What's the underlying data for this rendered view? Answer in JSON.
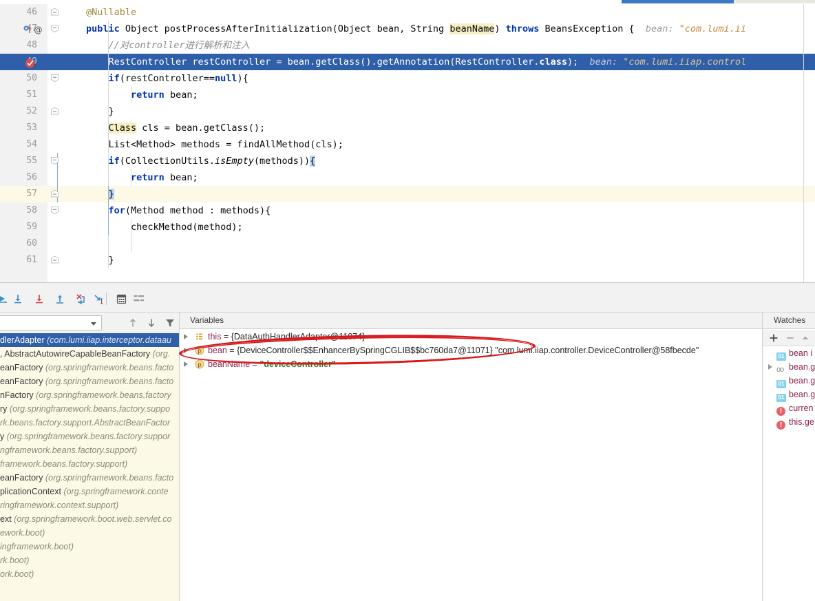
{
  "editor": {
    "lines": [
      {
        "num": "46",
        "indent": 1,
        "text": "@Nullable",
        "kind": "annotation"
      },
      {
        "num": "47",
        "indent": 1,
        "text": "public Object postProcessAfterInitialization(Object bean, String beanName) throws BeansException {",
        "kind": "signature",
        "hint_label": "bean:",
        "hint_value": "\"com.lumi.ii"
      },
      {
        "num": "48",
        "indent": 2,
        "text": "//对controller进行解析和注入",
        "kind": "comment"
      },
      {
        "num": "49",
        "indent": 2,
        "text": "RestController restController = bean.getClass().getAnnotation(RestController.class);",
        "kind": "executing",
        "hint_label": "bean:",
        "hint_value": "\"com.lumi.iiap.control"
      },
      {
        "num": "50",
        "indent": 2,
        "text": "if(restController==null){",
        "kind": "code"
      },
      {
        "num": "51",
        "indent": 3,
        "text": "return bean;",
        "kind": "code"
      },
      {
        "num": "52",
        "indent": 2,
        "text": "}",
        "kind": "code"
      },
      {
        "num": "53",
        "indent": 2,
        "text": "Class cls = bean.getClass();",
        "kind": "code"
      },
      {
        "num": "54",
        "indent": 2,
        "text": "List<Method> methods = findAllMethod(cls);",
        "kind": "code"
      },
      {
        "num": "55",
        "indent": 2,
        "text": "if(CollectionUtils.isEmpty(methods)){",
        "kind": "code"
      },
      {
        "num": "56",
        "indent": 3,
        "text": "return bean;",
        "kind": "code"
      },
      {
        "num": "57",
        "indent": 2,
        "text": "}",
        "kind": "caret"
      },
      {
        "num": "58",
        "indent": 2,
        "text": "for(Method method : methods){",
        "kind": "code"
      },
      {
        "num": "59",
        "indent": 3,
        "text": "checkMethod(method);",
        "kind": "code"
      },
      {
        "num": "60",
        "indent": 2,
        "text": "",
        "kind": "code"
      },
      {
        "num": "61",
        "indent": 2,
        "text": "}",
        "kind": "code"
      }
    ],
    "gutter": {
      "line47_markers": "override-marker-icon, annotation-icon",
      "line49_breakpoint": "breakpoint-verified-icon"
    },
    "colors": {
      "execution_line_bg": "#2f5fa8",
      "caret_line_bg": "#fcfae7",
      "keyword": "#0033b3",
      "comment": "#8c8c8c",
      "inline_hint": "#9a9a9a",
      "inline_hint_string": "#c8873a",
      "identifier_highlight": "#f7eec3"
    }
  },
  "debug_toolbar": {
    "buttons": [
      {
        "name": "show-execution-point",
        "glyph": "show-execution-point-icon"
      },
      {
        "name": "step-over",
        "glyph": "step-over-icon"
      },
      {
        "name": "step-into",
        "glyph": "step-into-icon"
      },
      {
        "name": "force-step-into",
        "glyph": "force-step-into-icon"
      },
      {
        "name": "step-out",
        "glyph": "step-out-icon"
      },
      {
        "name": "drop-frame",
        "glyph": "drop-frame-icon"
      },
      {
        "name": "run-to-cursor",
        "glyph": "run-to-cursor-icon"
      },
      {
        "name": "evaluate-expression",
        "glyph": "calculator-icon"
      },
      {
        "name": "settings-list",
        "glyph": "settings-list-icon"
      }
    ]
  },
  "frames": {
    "thread_selector_value": "",
    "toolbar_buttons": [
      {
        "name": "frames-up",
        "glyph": "arrow-up-icon"
      },
      {
        "name": "frames-down",
        "glyph": "arrow-down-icon"
      },
      {
        "name": "frames-filter",
        "glyph": "filter-icon"
      }
    ],
    "rows": [
      {
        "cls": "dlerAdapter",
        "pkg": "(com.lumi.iiap.interceptor.dataau",
        "selected": true
      },
      {
        "cls": ", AbstractAutowireCapableBeanFactory",
        "pkg": "(org.",
        "selected": false
      },
      {
        "cls": "eanFactory",
        "pkg": "(org.springframework.beans.facto",
        "selected": false
      },
      {
        "cls": "eanFactory",
        "pkg": "(org.springframework.beans.facto",
        "selected": false
      },
      {
        "cls": "nFactory",
        "pkg": "(org.springframework.beans.factory",
        "selected": false
      },
      {
        "cls": "ry",
        "pkg": "(org.springframework.beans.factory.suppo",
        "selected": false
      },
      {
        "cls": "",
        "pkg": "rk.beans.factory.support.AbstractBeanFactor",
        "selected": false
      },
      {
        "cls": "y",
        "pkg": "(org.springframework.beans.factory.suppor",
        "selected": false
      },
      {
        "cls": "",
        "pkg": "ngframework.beans.factory.support)",
        "selected": false
      },
      {
        "cls": "",
        "pkg": "framework.beans.factory.support)",
        "selected": false
      },
      {
        "cls": "eanFactory",
        "pkg": "(org.springframework.beans.facto",
        "selected": false
      },
      {
        "cls": "plicationContext",
        "pkg": "(org.springframework.conte",
        "selected": false
      },
      {
        "cls": "",
        "pkg": "ringframework.context.support)",
        "selected": false
      },
      {
        "cls": "ext",
        "pkg": "(org.springframework.boot.web.servlet.co",
        "selected": false
      },
      {
        "cls": "",
        "pkg": "ework.boot)",
        "selected": false
      },
      {
        "cls": "",
        "pkg": "ingframework.boot)",
        "selected": false
      },
      {
        "cls": "",
        "pkg": "rk.boot)",
        "selected": false
      },
      {
        "cls": "",
        "pkg": "ork.boot)",
        "selected": false
      }
    ]
  },
  "variables": {
    "title": "Variables",
    "rows": [
      {
        "icon": "field-list-icon",
        "name": "this",
        "eq": " = ",
        "value": "{DataAuthHandlerAdapter@11074}",
        "value_kind": "object",
        "expandable": true
      },
      {
        "icon": "parameter-icon",
        "name": "bean",
        "eq": " = ",
        "value": "{DeviceController$$EnhancerBySpringCGLIB$$bc760da7@11071} \"com.lumi.iiap.controller.DeviceController@58fbecde\"",
        "value_kind": "object",
        "expandable": true
      },
      {
        "icon": "parameter-icon",
        "name": "beanName",
        "eq": " = ",
        "value": "\"deviceController\"",
        "value_kind": "string",
        "expandable": true
      }
    ]
  },
  "watches": {
    "title": "Watches",
    "toolbar_buttons": [
      {
        "name": "add-watch",
        "glyph": "plus-icon"
      },
      {
        "name": "remove-watch",
        "glyph": "minus-icon"
      },
      {
        "name": "move-watch-up",
        "glyph": "caret-up-icon"
      }
    ],
    "rows": [
      {
        "icon": "primitive-value-icon",
        "text": "bean i",
        "expandable": false
      },
      {
        "icon": "object-reference-icon",
        "text": "bean.g",
        "expandable": true
      },
      {
        "icon": "primitive-value-icon",
        "text": "bean.g",
        "expandable": false
      },
      {
        "icon": "primitive-value-icon",
        "text": "bean.g",
        "expandable": false
      },
      {
        "icon": "error-icon",
        "text": "curren",
        "expandable": false
      },
      {
        "icon": "error-icon",
        "text": "this.ge",
        "expandable": false
      }
    ]
  },
  "annotation": {
    "shape": "red-ellipse-highlight",
    "color": "#d7191c",
    "targets": "variables bean row"
  }
}
